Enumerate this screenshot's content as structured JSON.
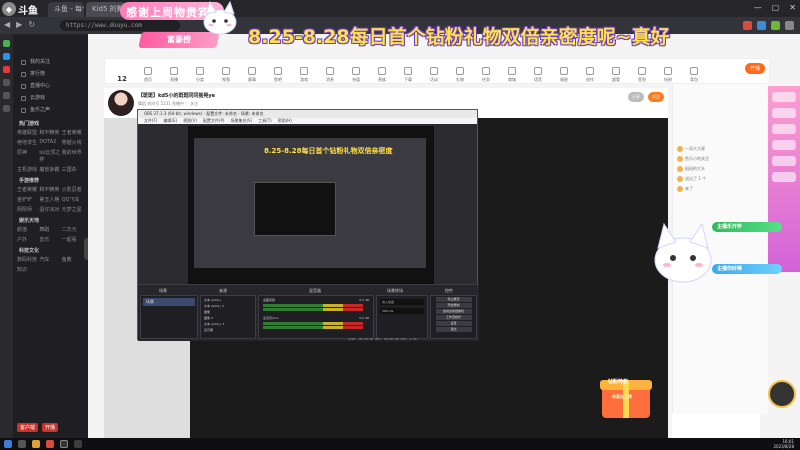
{
  "overlay": {
    "logo_text": "斗鱼",
    "banner_text": "感谢上周物贵宾",
    "banner_plate": "富豪榜",
    "headline": "8.25-8.28每日首个钻粉礼物双倍亲密度呢~真好"
  },
  "browser": {
    "tabs": [
      {
        "label": "斗鱼 - 每个人的直播平台"
      },
      {
        "label": "Kid5 的舞蹈乖乖"
      }
    ],
    "url": "https://www.douyu.com",
    "window_controls": [
      "—",
      "▢",
      "✕"
    ]
  },
  "sidebar": {
    "items": [
      "我的关注",
      "排行榜",
      "直播中心",
      "云游戏",
      "鱼乐之声"
    ],
    "section_hot": "热门游戏",
    "hot_games": [
      "英雄联盟",
      "和平精英",
      "王者荣耀",
      "绝地求生",
      "DOTA2",
      "穿越火线",
      "原神",
      "lol云顶之弈",
      "我的世界",
      "主机游戏",
      "魔兽争霸",
      "三国杀"
    ],
    "section_mobile": "手游推荐",
    "mobile_games": [
      "王者荣耀",
      "和平精英",
      "火影忍者",
      "金铲铲",
      "第五人格",
      "QQ飞车",
      "阴阳师",
      "蛋仔派对",
      "元梦之星"
    ],
    "section_fun": "娱乐天地",
    "fun": [
      "颜值",
      "舞蹈",
      "二次元",
      "户外",
      "音乐",
      "一起看"
    ],
    "section_tech": "科技文化",
    "tech": [
      "数码科技",
      "汽车",
      "鱼教",
      "知识"
    ],
    "bottom_buttons": [
      "客户端",
      "开播"
    ]
  },
  "nav": {
    "count_badge": "12",
    "items": [
      "首页",
      "直播",
      "分类",
      "视频",
      "赛事",
      "鱼吧",
      "游戏",
      "消息",
      "充值",
      "贵族",
      "下载",
      "活动",
      "礼物",
      "任务",
      "商城",
      "语音",
      "周星",
      "创作",
      "超管",
      "签到",
      "钻粉",
      "背包"
    ],
    "cta": "开播"
  },
  "room": {
    "title": "【斑斑】kd5小的斑斑同同摇晃ye",
    "subtitle": "舞蹈  房间号 5231  直播中  ♡ 关注",
    "follow_button": "关注",
    "share_button": "分享"
  },
  "obs": {
    "window_title": "OBS 27.1.3 (64-bit, windows) - 配置文件: 未命名 - 场景: 未命名",
    "menu": [
      "文件(F)",
      "编辑(E)",
      "视图(V)",
      "配置文件(P)",
      "场景集合(S)",
      "工具(T)",
      "帮助(H)"
    ],
    "inner_title": "8.25-8.28每日首个钻粉礼物双倍亲密度",
    "docks": {
      "scenes": "场景",
      "sources": "来源",
      "mixer": "混音器",
      "transitions": "场景转场",
      "controls": "控件"
    },
    "scene_items": [
      "场景"
    ],
    "source_items": [
      "文本 (GDI+)",
      "文本 (GDI+) 2",
      "图像",
      "图像 2",
      "文本 (GDI+) 3",
      "显示器"
    ],
    "mixer_tracks": [
      {
        "name": "桌面音频",
        "level": "0.0 dB"
      },
      {
        "name": "麦克风/Aux",
        "level": "0.0 dB"
      }
    ],
    "transition_value": "淡入淡出",
    "duration": "300 ms",
    "controls": [
      "停止推流",
      "开始录制",
      "启动虚拟摄像机",
      "工作室模式",
      "设置",
      "退出"
    ],
    "status": "LIVE: 00:00:00  REC: 00:00:00  CPU: 1.2%"
  },
  "right_panel": {
    "tabs": [
      "排行",
      "贵宾",
      "粉丝"
    ],
    "notice": "欢迎来到直播间！斗鱼严禁未成年人进行直播或打赏，请理性消费。",
    "chat": [
      "一双大大星",
      "鱼乐小的关注",
      "斑斑的大头",
      "送出了 1 个",
      "来了"
    ]
  },
  "overlay_widgets": {
    "ticker_1": "主播乐开怀",
    "ticker_2": "主播你好棒",
    "gift_title": "钻粉特权",
    "gift_sub": "恭喜你上榜"
  },
  "taskbar": {
    "time": "16:01",
    "date": "2023/8/28"
  }
}
